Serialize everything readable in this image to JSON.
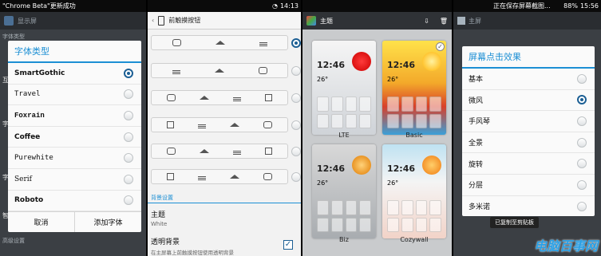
{
  "panel1": {
    "status_text": "\"Chrome Beta\"更新成功",
    "title": "显示屏",
    "bg_labels": [
      "字体类型",
      "字",
      "互",
      "字",
      "字",
      "字",
      "智",
      "高级设置"
    ],
    "dialog": {
      "title": "字体类型",
      "options": [
        {
          "label": "SmartGothic",
          "selected": true
        },
        {
          "label": "Travel",
          "selected": false
        },
        {
          "label": "Foxrain",
          "selected": false
        },
        {
          "label": "Coffee",
          "selected": false
        },
        {
          "label": "Purewhite",
          "selected": false
        },
        {
          "label": "Serif",
          "selected": false
        },
        {
          "label": "Roboto",
          "selected": false
        }
      ],
      "cancel": "取消",
      "add": "添加字体"
    }
  },
  "panel2": {
    "time": "14:13",
    "title": "前触摸按钮",
    "section": "背景设置",
    "theme_title": "主题",
    "theme_value": "White",
    "transparent_title": "透明背景",
    "transparent_desc": "在主屏幕上前触摸按钮使用透明背景"
  },
  "panel3": {
    "title": "主题",
    "themes": [
      "LTE",
      "Basic",
      "Biz",
      "Cozywall"
    ],
    "clock": "12:46",
    "temp": "26°"
  },
  "panel4": {
    "status_text": "正在保存屏幕截图...",
    "battery": "88%",
    "time": "15:56",
    "title": "主屏",
    "dialog": {
      "title": "屏幕点击效果",
      "options": [
        {
          "label": "基本",
          "selected": false
        },
        {
          "label": "微风",
          "selected": true
        },
        {
          "label": "手风琴",
          "selected": false
        },
        {
          "label": "全景",
          "selected": false
        },
        {
          "label": "旋转",
          "selected": false
        },
        {
          "label": "分层",
          "selected": false
        },
        {
          "label": "多米诺",
          "selected": false
        }
      ]
    },
    "toast": "已复制至剪贴板"
  },
  "watermark": "电脑百事网",
  "colors": {
    "accent": "#1c8fd4",
    "radio_on": "#1c5f94",
    "dim": "#3b3f44"
  }
}
